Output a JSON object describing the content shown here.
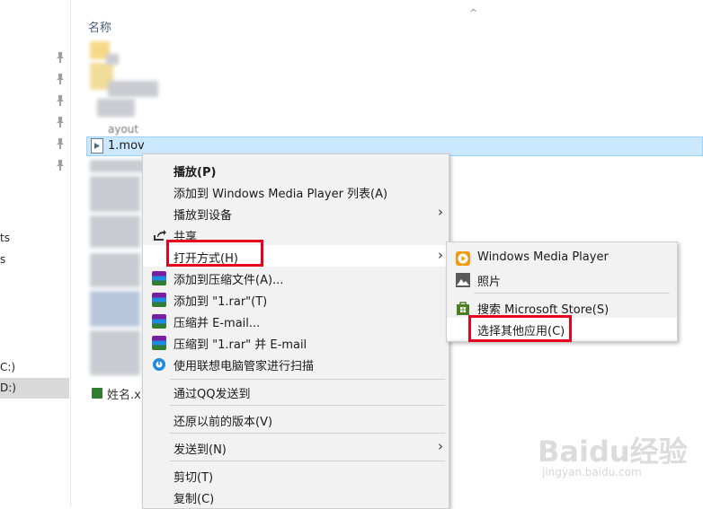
{
  "nav": {
    "fragment_1": "ts",
    "fragment_2": "s",
    "drive_c": "C:)",
    "drive_d": "D:)"
  },
  "filelist": {
    "column_name": "名称",
    "selected_file": "1.mov",
    "partial_file_1": "ayout",
    "partial_file_2": "姓名.xl"
  },
  "context_menu": {
    "play": "播放(P)",
    "add_to_wmp": "添加到 Windows Media Player 列表(A)",
    "cast_to_device": "播放到设备",
    "share": "共享",
    "open_with": "打开方式(H)",
    "add_to_archive": "添加到压缩文件(A)...",
    "add_to_rar": "添加到 \"1.rar\"(T)",
    "compress_email": "压缩并 E-mail...",
    "compress_rar_email": "压缩到 \"1.rar\" 并 E-mail",
    "lenovo_scan": "使用联想电脑管家进行扫描",
    "send_via_qq": "通过QQ发送到",
    "restore_previous": "还原以前的版本(V)",
    "send_to": "发送到(N)",
    "cut": "剪切(T)",
    "copy": "复制(C)"
  },
  "open_with_menu": {
    "wmp": "Windows Media Player",
    "photos": "照片",
    "search_store": "搜索 Microsoft Store(S)",
    "choose_other": "选择其他应用(C)"
  },
  "watermark": {
    "brand": "Baidu经验",
    "url": "jingyan.baidu.com"
  },
  "colors": {
    "selection": "#cce8ff",
    "highlight_box": "#e8001c",
    "menu_bg": "#f2f2f2"
  }
}
